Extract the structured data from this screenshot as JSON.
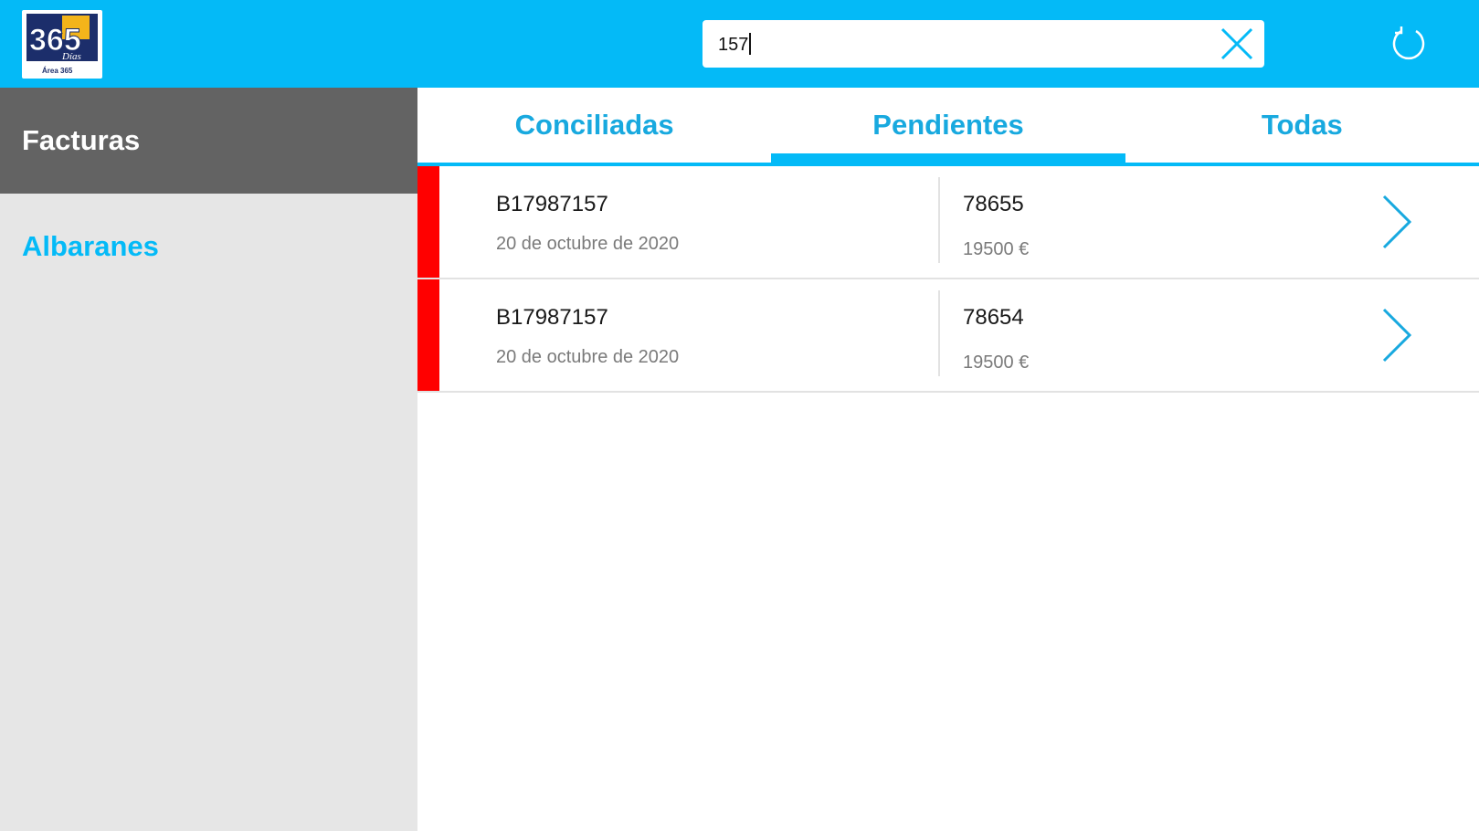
{
  "header": {
    "logo": {
      "main_text": "365",
      "sub_text": "Días",
      "caption": "Área 365"
    },
    "search": {
      "value": "157",
      "clear_icon": "close-icon"
    },
    "refresh_icon": "refresh-icon",
    "accent_color": "#04baf7"
  },
  "sidebar": {
    "items": [
      {
        "label": "Facturas",
        "active": true
      },
      {
        "label": "Albaranes",
        "active": false
      }
    ]
  },
  "tabs": [
    {
      "label": "Conciliadas",
      "active": false
    },
    {
      "label": "Pendientes",
      "active": true
    },
    {
      "label": "Todas",
      "active": false
    }
  ],
  "list": [
    {
      "id": "B17987157",
      "date": "20 de octubre de 2020",
      "number": "78655",
      "amount": "19500 €",
      "status_color": "#ff0000"
    },
    {
      "id": "B17987157",
      "date": "20 de octubre de 2020",
      "number": "78654",
      "amount": "19500 €",
      "status_color": "#ff0000"
    }
  ]
}
